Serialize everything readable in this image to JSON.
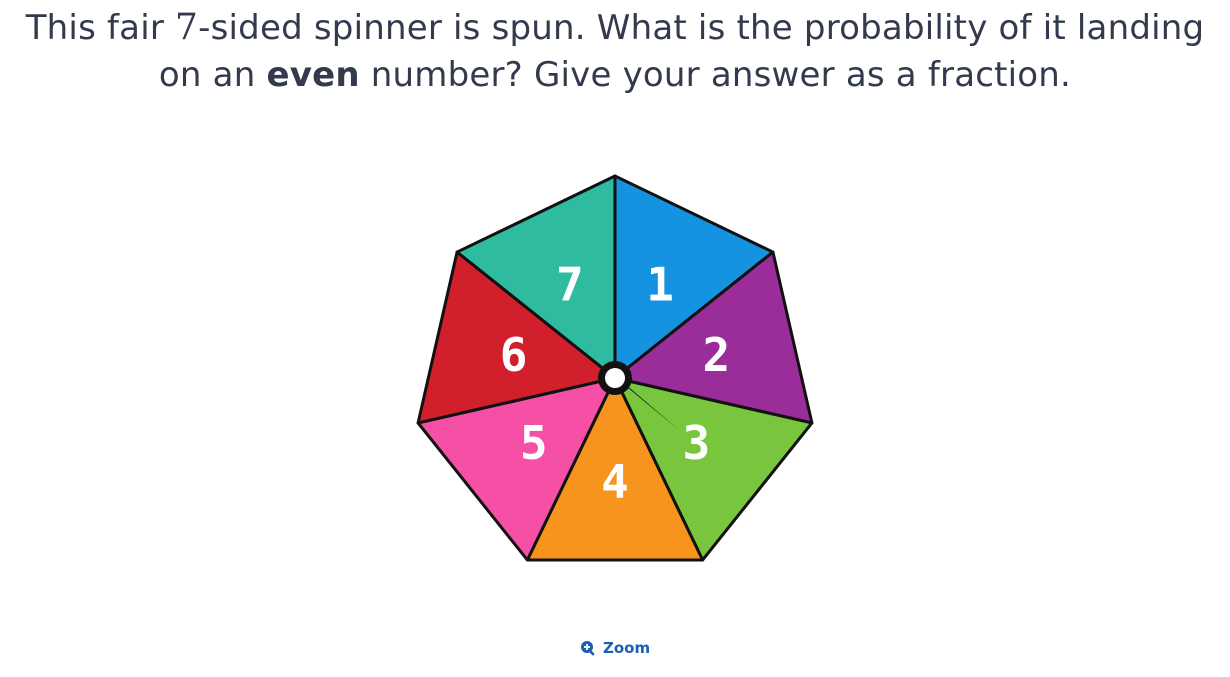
{
  "question": {
    "part1": "This fair ",
    "sides": "7",
    "part2": "-sided spinner is spun. What is the probability of it landing",
    "part3": "on an ",
    "emphasis": "even",
    "part4": " number? Give your answer as a fraction."
  },
  "spinner": {
    "sectors": [
      {
        "label": "1",
        "color": "#1592e0"
      },
      {
        "label": "2",
        "color": "#9b2d9a"
      },
      {
        "label": "3",
        "color": "#79c53d"
      },
      {
        "label": "4",
        "color": "#f7941d"
      },
      {
        "label": "5",
        "color": "#f54fa6"
      },
      {
        "label": "6",
        "color": "#d11f2c"
      },
      {
        "label": "7",
        "color": "#2fbba0"
      }
    ]
  },
  "zoom": {
    "label": "Zoom",
    "icon": "zoom-in-icon",
    "color": "#1a5fb4"
  }
}
